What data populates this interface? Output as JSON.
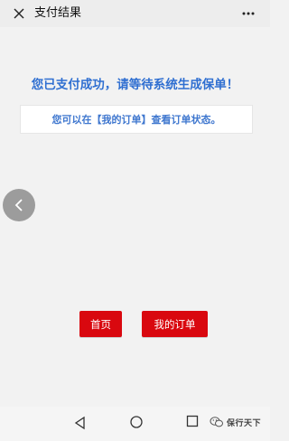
{
  "topbar": {
    "title": "支付结果",
    "close_icon": "close-icon",
    "more_icon": "more-icon"
  },
  "main": {
    "success_message": "您已支付成功，请等待系统生成保单！",
    "info_message": "您可以在【我的订单】查看订单状态。"
  },
  "buttons": {
    "home_label": "首页",
    "orders_label": "我的订单"
  },
  "floating": {
    "back_icon": "chevron-left-icon"
  },
  "nav": {
    "back_icon": "triangle-back-icon",
    "home_icon": "circle-home-icon",
    "recent_icon": "square-recent-icon"
  },
  "watermark": {
    "text": "保行天下"
  },
  "colors": {
    "primary_blue": "#2f6fd1",
    "button_red": "#d9080f",
    "background": "#f2f2f2"
  }
}
